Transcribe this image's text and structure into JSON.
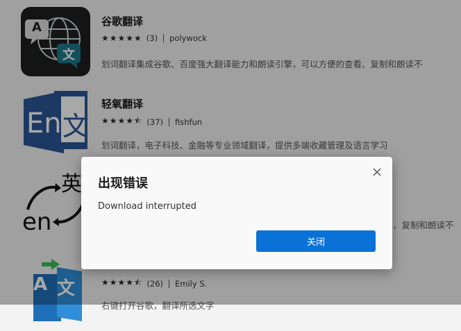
{
  "extensions": [
    {
      "name": "谷歌翻译",
      "stars": "★★★★★",
      "count": "(3)",
      "author": "polywock",
      "description": "划词翻译集成谷歌、百度强大翻译能力和朗读引擎，可以方便的查看、复制和朗读不"
    },
    {
      "name": "轻氧翻译",
      "stars": "★★★★⯪",
      "count": "(37)",
      "author": "fishfun",
      "description": "划词翻译，电子科技、金融等专业领域翻译，提供多端收藏管理及语言学习"
    },
    {
      "description": "、复制和朗读不"
    },
    {
      "stars": "★★★★⯪",
      "count": "(26)",
      "author": "Emily S.",
      "description": "右键打开谷歌，翻译所选文字"
    }
  ],
  "icon_texts": {
    "icon1_a": "A",
    "icon1_b": "文",
    "icon2_en": "En",
    "icon2_b": "文",
    "icon3_top": "英",
    "icon3_bottom": "en",
    "icon4_a": "A",
    "icon4_b": "文"
  },
  "dialog": {
    "title": "出现错误",
    "message": "Download interrupted",
    "close_button": "关闭"
  },
  "colors": {
    "accent": "#0a72d6",
    "icon2_blue": "#2b5797"
  }
}
